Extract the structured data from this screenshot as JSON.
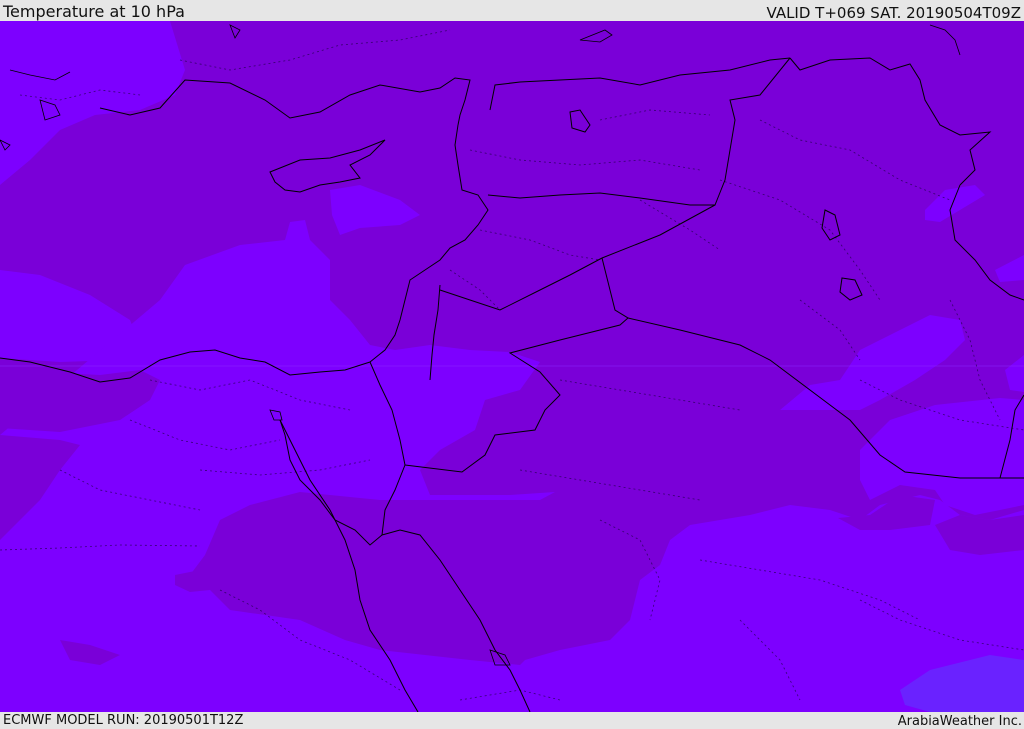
{
  "header": {
    "title": "Temperature at 10 hPa",
    "valid_time": "VALID T+069 SAT. 20190504T09Z"
  },
  "footer": {
    "model_run": "ECMWF MODEL RUN: 20190501T12Z",
    "credit": "ArabiaWeather Inc."
  },
  "colors": {
    "field_dark": "#7a00d8",
    "field_mid": "#7d00ff",
    "field_blue": "#6a22ff",
    "border_line": "#000000",
    "bar_background": "#e6e6e6"
  }
}
